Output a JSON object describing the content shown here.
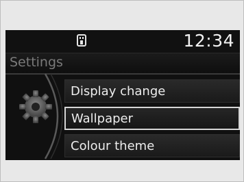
{
  "status": {
    "usb_icon": "usb-icon",
    "clock": "12:34"
  },
  "header": {
    "title": "Settings"
  },
  "sidebar": {
    "icon": "gear-icon"
  },
  "menu": {
    "items": [
      {
        "label": "Display change",
        "selected": false
      },
      {
        "label": "Wallpaper",
        "selected": true
      },
      {
        "label": "Colour theme",
        "selected": false
      }
    ]
  }
}
